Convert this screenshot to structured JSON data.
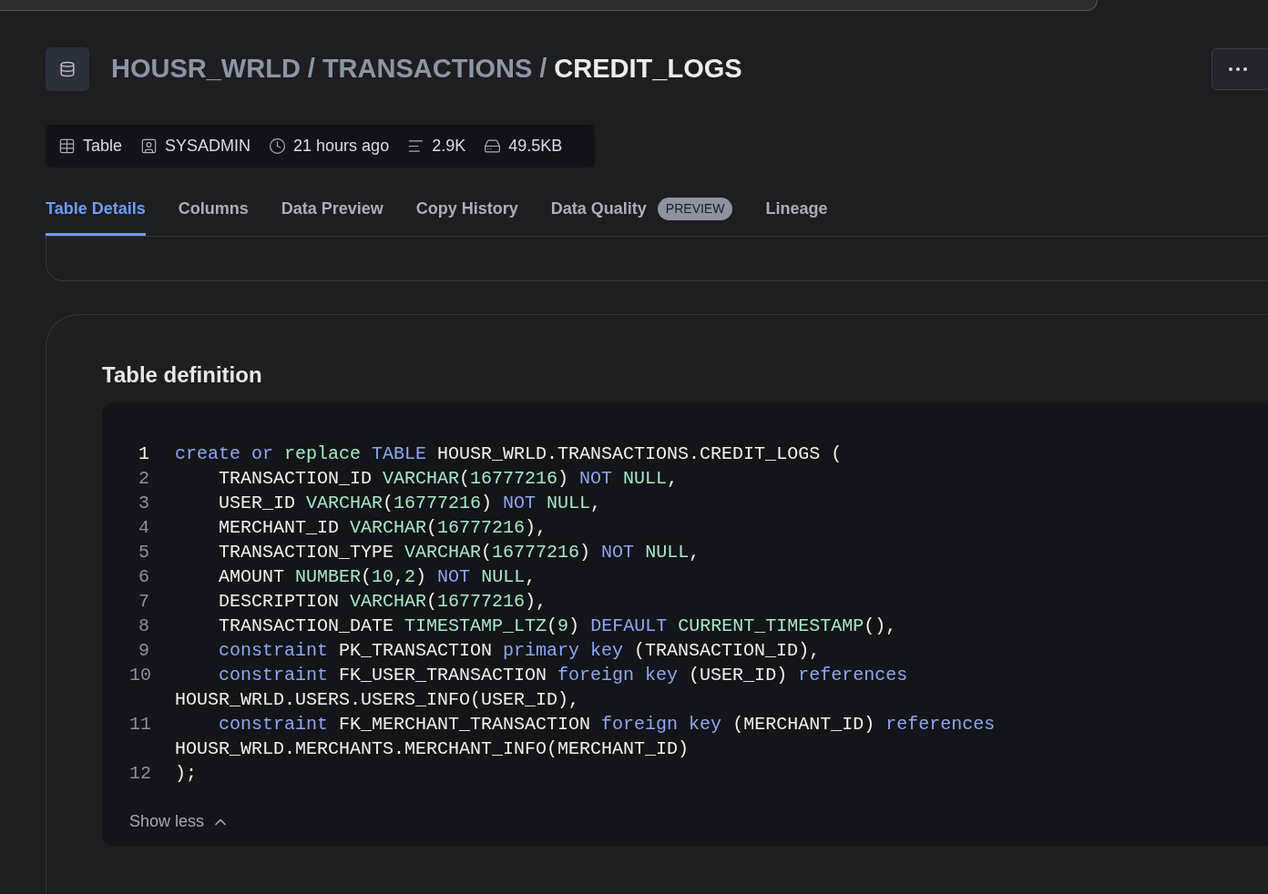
{
  "breadcrumb": {
    "separator": "/",
    "items": [
      {
        "label": "HOUSR_WRLD",
        "current": false
      },
      {
        "label": "TRANSACTIONS",
        "current": false
      },
      {
        "label": "CREDIT_LOGS",
        "current": true
      }
    ]
  },
  "meta": [
    {
      "kind": "table",
      "text": "Table"
    },
    {
      "kind": "owner",
      "text": "SYSADMIN"
    },
    {
      "kind": "time",
      "text": "21 hours ago"
    },
    {
      "kind": "rows",
      "text": "2.9K"
    },
    {
      "kind": "size",
      "text": "49.5KB"
    }
  ],
  "tabs": [
    {
      "label": "Table Details",
      "selected": true
    },
    {
      "label": "Columns",
      "selected": false
    },
    {
      "label": "Data Preview",
      "selected": false
    },
    {
      "label": "Copy History",
      "selected": false
    },
    {
      "label": "Data Quality",
      "selected": false,
      "badge": "PREVIEW"
    },
    {
      "label": "Lineage",
      "selected": false
    }
  ],
  "definition": {
    "title": "Table definition",
    "toggle": "Show less",
    "expanded": true,
    "lines": [
      {
        "number": "1",
        "current": true,
        "indented": false,
        "tokens": [
          {
            "kind": "keyword",
            "text": "create or "
          },
          {
            "kind": "type",
            "text": "replace "
          },
          {
            "kind": "keyword",
            "text": "TABLE"
          },
          {
            "kind": "plain",
            "text": " HOUSR_WRLD.TRANSACTIONS.CREDIT_LOGS ("
          }
        ]
      },
      {
        "number": "2",
        "current": false,
        "indented": true,
        "tokens": [
          {
            "kind": "plain",
            "text": "TRANSACTION_ID "
          },
          {
            "kind": "type",
            "text": "VARCHAR"
          },
          {
            "kind": "plain",
            "text": "("
          },
          {
            "kind": "type",
            "text": "16777216"
          },
          {
            "kind": "plain",
            "text": ") "
          },
          {
            "kind": "keyword",
            "text": "NOT "
          },
          {
            "kind": "type",
            "text": "NULL"
          },
          {
            "kind": "plain",
            "text": ","
          }
        ]
      },
      {
        "number": "3",
        "current": false,
        "indented": true,
        "tokens": [
          {
            "kind": "plain",
            "text": "USER_ID "
          },
          {
            "kind": "type",
            "text": "VARCHAR"
          },
          {
            "kind": "plain",
            "text": "("
          },
          {
            "kind": "type",
            "text": "16777216"
          },
          {
            "kind": "plain",
            "text": ") "
          },
          {
            "kind": "keyword",
            "text": "NOT "
          },
          {
            "kind": "type",
            "text": "NULL"
          },
          {
            "kind": "plain",
            "text": ","
          }
        ]
      },
      {
        "number": "4",
        "current": false,
        "indented": true,
        "tokens": [
          {
            "kind": "plain",
            "text": "MERCHANT_ID "
          },
          {
            "kind": "type",
            "text": "VARCHAR"
          },
          {
            "kind": "plain",
            "text": "("
          },
          {
            "kind": "type",
            "text": "16777216"
          },
          {
            "kind": "plain",
            "text": "),"
          }
        ]
      },
      {
        "number": "5",
        "current": false,
        "indented": true,
        "tokens": [
          {
            "kind": "plain",
            "text": "TRANSACTION_TYPE "
          },
          {
            "kind": "type",
            "text": "VARCHAR"
          },
          {
            "kind": "plain",
            "text": "("
          },
          {
            "kind": "type",
            "text": "16777216"
          },
          {
            "kind": "plain",
            "text": ") "
          },
          {
            "kind": "keyword",
            "text": "NOT "
          },
          {
            "kind": "type",
            "text": "NULL"
          },
          {
            "kind": "plain",
            "text": ","
          }
        ]
      },
      {
        "number": "6",
        "current": false,
        "indented": true,
        "tokens": [
          {
            "kind": "plain",
            "text": "AMOUNT "
          },
          {
            "kind": "type",
            "text": "NUMBER"
          },
          {
            "kind": "plain",
            "text": "("
          },
          {
            "kind": "type",
            "text": "10"
          },
          {
            "kind": "plain",
            "text": ","
          },
          {
            "kind": "type",
            "text": "2"
          },
          {
            "kind": "plain",
            "text": ") "
          },
          {
            "kind": "keyword",
            "text": "NOT "
          },
          {
            "kind": "type",
            "text": "NULL"
          },
          {
            "kind": "plain",
            "text": ","
          }
        ]
      },
      {
        "number": "7",
        "current": false,
        "indented": true,
        "tokens": [
          {
            "kind": "plain",
            "text": "DESCRIPTION "
          },
          {
            "kind": "type",
            "text": "VARCHAR"
          },
          {
            "kind": "plain",
            "text": "("
          },
          {
            "kind": "type",
            "text": "16777216"
          },
          {
            "kind": "plain",
            "text": "),"
          }
        ]
      },
      {
        "number": "8",
        "current": false,
        "indented": true,
        "tokens": [
          {
            "kind": "plain",
            "text": "TRANSACTION_DATE "
          },
          {
            "kind": "type",
            "text": "TIMESTAMP_LTZ"
          },
          {
            "kind": "plain",
            "text": "("
          },
          {
            "kind": "type",
            "text": "9"
          },
          {
            "kind": "plain",
            "text": ") "
          },
          {
            "kind": "keyword",
            "text": "DEFAULT "
          },
          {
            "kind": "type",
            "text": "CURRENT_TIMESTAMP"
          },
          {
            "kind": "plain",
            "text": "(),"
          }
        ]
      },
      {
        "number": "9",
        "current": false,
        "indented": true,
        "tokens": [
          {
            "kind": "keyword",
            "text": "constraint"
          },
          {
            "kind": "plain",
            "text": " PK_TRANSACTION "
          },
          {
            "kind": "keyword",
            "text": "primary key"
          },
          {
            "kind": "plain",
            "text": " (TRANSACTION_ID),"
          }
        ]
      },
      {
        "number": "10",
        "current": false,
        "indented": true,
        "tokens": [
          {
            "kind": "keyword",
            "text": "constraint"
          },
          {
            "kind": "plain",
            "text": " FK_USER_TRANSACTION "
          },
          {
            "kind": "keyword",
            "text": "foreign key"
          },
          {
            "kind": "plain",
            "text": " (USER_ID) "
          },
          {
            "kind": "keyword",
            "text": "references"
          },
          {
            "kind": "plain",
            "text": " HOUSR_WRLD.USERS.USERS_INFO(USER_ID),"
          }
        ]
      },
      {
        "number": "11",
        "current": false,
        "indented": true,
        "tokens": [
          {
            "kind": "keyword",
            "text": "constraint"
          },
          {
            "kind": "plain",
            "text": " FK_MERCHANT_TRANSACTION "
          },
          {
            "kind": "keyword",
            "text": "foreign key"
          },
          {
            "kind": "plain",
            "text": " (MERCHANT_ID) "
          },
          {
            "kind": "keyword",
            "text": "references"
          },
          {
            "kind": "plain",
            "text": " HOUSR_WRLD.MERCHANTS.MERCHANT_INFO(MERCHANT_ID)"
          }
        ]
      },
      {
        "number": "12",
        "current": false,
        "indented": false,
        "tokens": [
          {
            "kind": "plain",
            "text": ");"
          }
        ]
      }
    ]
  }
}
